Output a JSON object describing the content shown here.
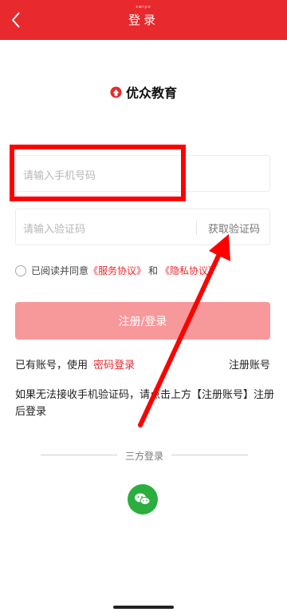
{
  "header": {
    "title": "登录",
    "subtitle": "swipe",
    "back_icon": "chevron-left-icon",
    "background": "#e8292d"
  },
  "brand": {
    "name": "优众教育",
    "logo_icon": "brand-logo-icon"
  },
  "form": {
    "phone_placeholder": "请输入手机号码",
    "code_placeholder": "请输入验证码",
    "get_code_label": "获取验证码"
  },
  "agreement": {
    "prefix": "已阅读并同意",
    "service_link": "《服务协议》",
    "and": "和",
    "privacy_link": "《隐私协议》",
    "checked": false
  },
  "submit_label": "注册/登录",
  "account_row": {
    "prefix": "已有账号，使用",
    "password_login_link": "密码登录",
    "register_link": "注册账号"
  },
  "hint_text": "如果无法接收手机验证码，请点击上方【注册账号】注册后登录",
  "third_party": {
    "label": "三方登录",
    "wechat_icon": "wechat-icon"
  },
  "colors": {
    "accent": "#e8292d",
    "submit_disabled": "#f7989b",
    "annotation": "#ff0000",
    "wechat": "#2aae3e"
  }
}
